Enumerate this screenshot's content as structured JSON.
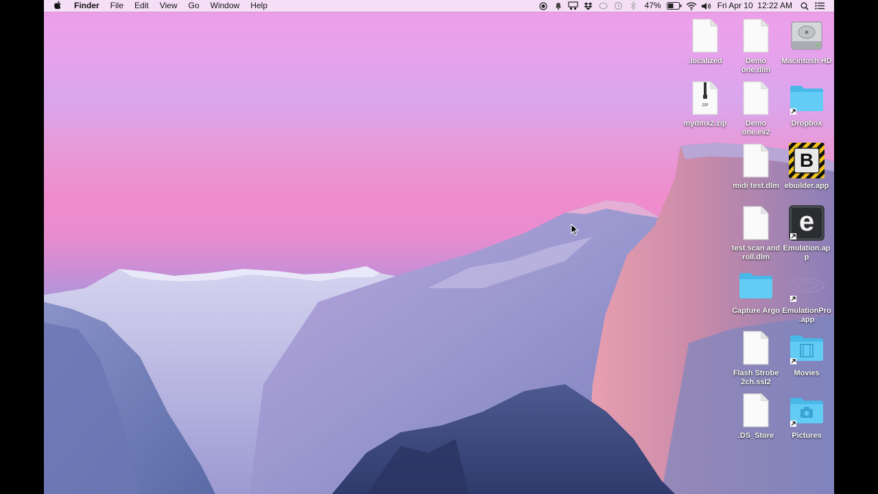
{
  "menubar": {
    "apple_glyph": "",
    "app_name": "Finder",
    "menus": [
      "File",
      "Edit",
      "View",
      "Go",
      "Window",
      "Help"
    ],
    "battery": "47%",
    "clock": "Fri Apr 10  12:22 AM"
  },
  "desktop": {
    "items": [
      {
        "label": ".localized",
        "icon": "document-icon"
      },
      {
        "label": "Demo one.dlm",
        "icon": "document-icon"
      },
      {
        "label": "Macintosh HD",
        "icon": "hard-drive-icon"
      },
      {
        "label": "mydmx2.zip",
        "icon": "zip-archive-icon",
        "badge": "ZIP"
      },
      {
        "label": "Demo one.ev2",
        "icon": "document-icon"
      },
      {
        "label": "Dropbox",
        "icon": "folder-alias-icon"
      },
      {
        "label": "midi test.dlm",
        "icon": "document-icon"
      },
      {
        "label": "ebuilder.app",
        "icon": "ebuilder-app-icon",
        "glyph": "B"
      },
      {
        "label": "test scan and roll.dlm",
        "icon": "document-icon"
      },
      {
        "label": "Emulation.app",
        "icon": "emulation-app-icon",
        "glyph": "e"
      },
      {
        "label": "Capture Argo",
        "icon": "folder-icon"
      },
      {
        "label": "EmulationPro.app",
        "icon": "emulationpro-app-icon"
      },
      {
        "label": "Flash Strobe 2ch.ssl2",
        "icon": "document-icon"
      },
      {
        "label": "Movies",
        "icon": "movies-folder-icon"
      },
      {
        "label": ".DS_Store",
        "icon": "document-icon"
      },
      {
        "label": "Pictures",
        "icon": "pictures-folder-icon"
      }
    ]
  },
  "colors": {
    "folder_blue": "#4fc3ef",
    "sky_top": "#ee9ee8",
    "sky_pink": "#f08ccc",
    "mountain_blue": "#8f8fcc"
  }
}
